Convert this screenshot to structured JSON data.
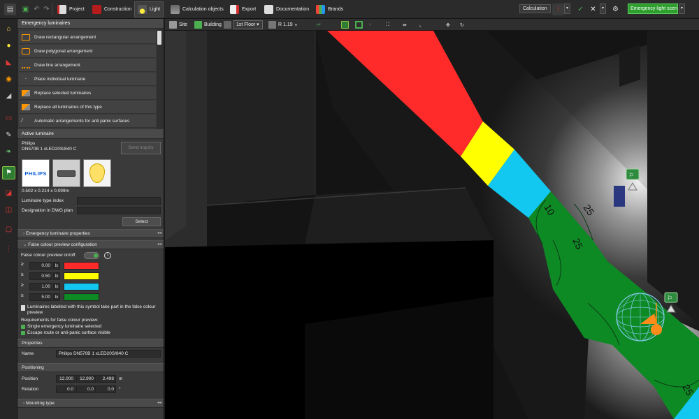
{
  "topbar": {
    "menu": [
      {
        "label": "Project",
        "icon": "project-icon"
      },
      {
        "label": "Construction",
        "icon": "construction-icon"
      },
      {
        "label": "Light",
        "icon": "light-icon",
        "active": true
      },
      {
        "label": "Calculation objects",
        "icon": "calculation-objects-icon"
      },
      {
        "label": "Export",
        "icon": "export-icon"
      },
      {
        "label": "Documentation",
        "icon": "documentation-icon"
      },
      {
        "label": "Brands",
        "icon": "brands-icon"
      }
    ],
    "calculation_label": "Calculation",
    "scene_label": "Emergency light scene"
  },
  "panel": {
    "title": "Emergency luminaires",
    "arrangements": [
      "Draw rectangular arrangement",
      "Draw polygonal arrangement",
      "Draw line arrangement",
      "Place individual luminaire",
      "Replace selected luminaires",
      "Replace all luminaires of this type",
      "Automatic arrangements for anti panic surfaces"
    ],
    "active_luminaire": {
      "header": "Active luminaire",
      "brand": "Philips",
      "model": "DN570B 1 xLED20S/840 C",
      "send_inquiry": "Send inquiry",
      "logo_text": "PHILIPS",
      "dimensions": "0.502 x 0.214 x 0.099m",
      "type_index_label": "Luminaire type index",
      "type_index_value": "",
      "designation_label": "Designation in DWG plan",
      "designation_value": "",
      "select_label": "Select"
    },
    "props_header": "Emergency luminaire properties",
    "false_colour": {
      "header": "False colour preview configuration",
      "toggle_label": "False colour preview on/off",
      "rows": [
        {
          "symbol": "≥",
          "value": "0.00",
          "unit": "lx",
          "color": "#ff2b2b"
        },
        {
          "symbol": "≥",
          "value": "0.50",
          "unit": "lx",
          "color": "#ffff00"
        },
        {
          "symbol": "≥",
          "value": "1.00",
          "unit": "lx",
          "color": "#13c8f0"
        },
        {
          "symbol": "≥",
          "value": "5.00",
          "unit": "lx",
          "color": "#0e8a25"
        }
      ],
      "note": "Luminaires labelled with this symbol take part in the false colour preview",
      "req_title": "Requirements for false colour preview:",
      "req_1": "Single emergency luminaire selected",
      "req_2": "Escape route or anti-panic surface visible"
    },
    "properties": {
      "header": "Properties",
      "name_label": "Name",
      "name_value": "Philips DN570B 1 xLED20S/840 C"
    },
    "positioning": {
      "header": "Positioning",
      "position_label": "Position",
      "position": [
        "12.000",
        "12.900",
        "2.498"
      ],
      "position_unit": "m",
      "rotation_label": "Rotation",
      "rotation": [
        "0.0",
        "0.0",
        "0.0"
      ],
      "rotation_unit": "°"
    },
    "mounting_header": "Mounting type"
  },
  "viewport_toolbar": {
    "site": "Site",
    "building": "Building",
    "floor": "1st Floor",
    "room": "R 1.19"
  },
  "viewport": {
    "contour_labels": [
      "10",
      "25",
      "25",
      "25"
    ],
    "colors": {
      "red": "#ff2b2b",
      "yellow": "#ffff00",
      "cyan": "#13c8f0",
      "green": "#0e8a25"
    }
  }
}
